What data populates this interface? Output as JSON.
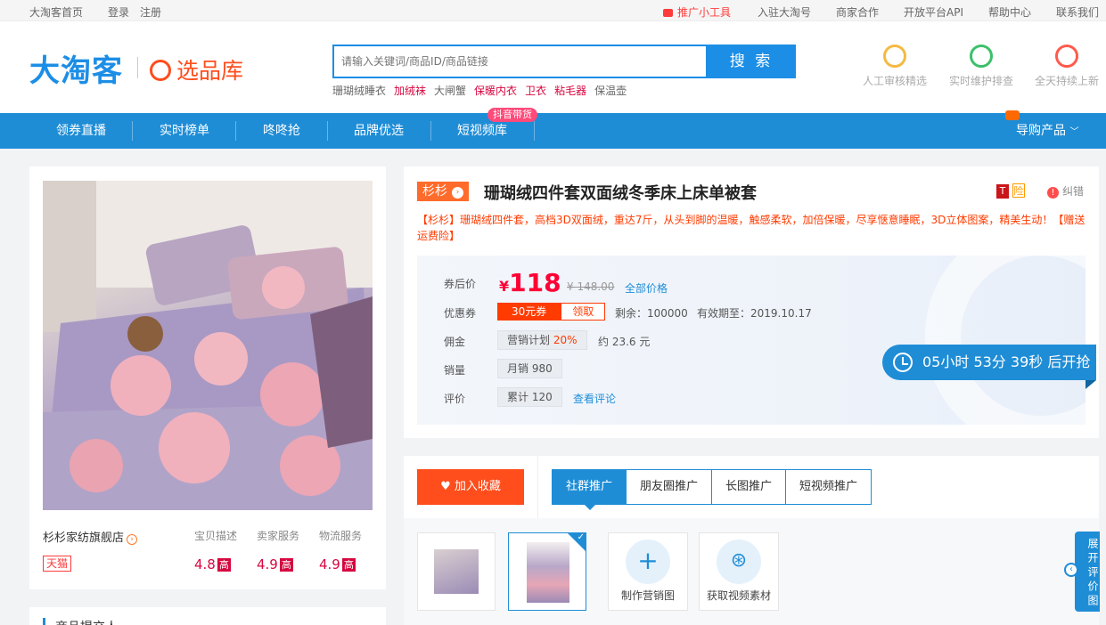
{
  "topbar": {
    "home": "大淘客首页",
    "login": "登录",
    "register": "注册",
    "promo_tool": "推广小工具",
    "join": "入驻大淘号",
    "merchant": "商家合作",
    "api": "开放平台API",
    "help": "帮助中心",
    "contact": "联系我们"
  },
  "header": {
    "logo": "大淘客",
    "logo_sub": "选品库",
    "search_placeholder": "请输入关键词/商品ID/商品链接",
    "search_button": "搜 索",
    "hot_words": [
      {
        "text": "珊瑚绒睡衣",
        "red": false
      },
      {
        "text": "加绒袜",
        "red": true
      },
      {
        "text": "大闸蟹",
        "red": false
      },
      {
        "text": "保暖内衣",
        "red": true
      },
      {
        "text": "卫衣",
        "red": true
      },
      {
        "text": "粘毛器",
        "red": true
      },
      {
        "text": "保温壶",
        "red": false
      }
    ],
    "features": [
      {
        "label": "人工审核精选",
        "icon": "user-icon",
        "color": "#f5b942"
      },
      {
        "label": "实时维护排查",
        "icon": "shield-check-icon",
        "color": "#3cc06a"
      },
      {
        "label": "全天持续上新",
        "icon": "flame-icon",
        "color": "#ff5a4d"
      }
    ]
  },
  "nav": {
    "items": [
      "领券直播",
      "实时榜单",
      "咚咚抢",
      "品牌优选",
      "短视频库"
    ],
    "badge": "抖音带货",
    "right": "导购产品"
  },
  "product": {
    "shop_name": "杉杉家纺旗舰店",
    "platform": "天猫",
    "score_headers": [
      "宝贝描述",
      "卖家服务",
      "物流服务"
    ],
    "scores": [
      "4.8",
      "4.9",
      "4.9"
    ],
    "score_grade": "高",
    "brand": "杉杉",
    "title": "珊瑚绒四件套双面绒冬季床上床单被套",
    "report": "纠错",
    "description": "【杉杉】珊瑚绒四件套，高档3D双面绒，重达7斤，从头到脚的温暖，触感柔软，加倍保暖，尽享惬意睡眠，3D立体图案，精美生动！【赠送运费险】",
    "price_label": "券后价",
    "currency": "¥",
    "price": "118",
    "original_price": "¥ 148.00",
    "all_price_link": "全部价格",
    "coupon_label": "优惠券",
    "coupon_value": "30元券",
    "coupon_take": "领取",
    "remaining": "剩余：100000",
    "valid_until": "有效期至：2019.10.17",
    "commission_label": "佣金",
    "commission_plan": "营销计划",
    "commission_rate": "20%",
    "commission_amount": "约 23.6 元",
    "sales_label": "销量",
    "sales_value": "月销 980",
    "review_label": "评价",
    "review_value": "累计 120",
    "review_link": "查看评论",
    "countdown": "05小时 53分 39秒 后开抢",
    "reviewer_heading": "商品提交人"
  },
  "promo": {
    "favorite": "加入收藏",
    "tabs": [
      "社群推广",
      "朋友圈推广",
      "长图推广",
      "短视频推广"
    ],
    "tools": [
      "制作营销图",
      "获取视频素材"
    ],
    "expand": "展开评价图"
  },
  "colors": {
    "primary": "#1f8dd6",
    "accent": "#ff4d1c",
    "price": "#ff0036"
  }
}
